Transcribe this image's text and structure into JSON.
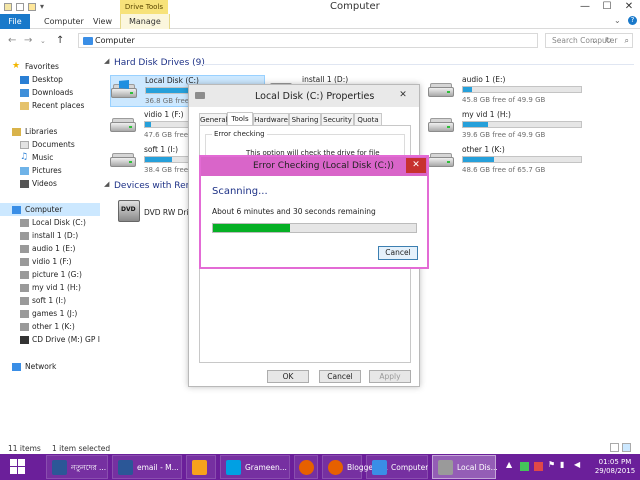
{
  "titlebar": {
    "context_tab": "Drive Tools",
    "title": "Computer",
    "min": "—",
    "max": "☐",
    "close": "✕"
  },
  "ribbon": {
    "file": "File",
    "tabs": [
      "Computer",
      "View",
      "Manage"
    ]
  },
  "address": {
    "path": "Computer",
    "search_placeholder": "Search Computer"
  },
  "nav": {
    "favorites": "Favorites",
    "desktop": "Desktop",
    "downloads": "Downloads",
    "recent": "Recent places",
    "libraries": "Libraries",
    "documents": "Documents",
    "music": "Music",
    "pictures": "Pictures",
    "videos": "Videos",
    "computer": "Computer",
    "drives": [
      "Local Disk (C:)",
      "install 1 (D:)",
      "audio 1 (E:)",
      "vidio 1 (F:)",
      "picture 1 (G:)",
      "my vid 1 (H:)",
      "soft 1 (I:)",
      "games 1 (J:)",
      "other 1 (K:)",
      "CD Drive (M:) GP Int"
    ],
    "network": "Network"
  },
  "content": {
    "hdd_header": "Hard Disk Drives (9)",
    "devices_header": "Devices with Remo",
    "drives": [
      {
        "name": "Local Disk (C:)",
        "free": "36.8 GB free o",
        "used": 0.38
      },
      {
        "name": "install 1 (D:)",
        "free": "",
        "used": 0.0
      },
      {
        "name": "audio 1 (E:)",
        "free": "45.8 GB free of 49.9 GB",
        "used": 0.08
      },
      {
        "name": "vidio 1 (F:)",
        "free": "47.6 GB free o",
        "used": 0.05
      },
      {
        "name": "my vid 1 (H:)",
        "free": "39.6 GB free of 49.9 GB",
        "used": 0.21
      },
      {
        "name": "soft 1 (I:)",
        "free": "38.4 GB free o",
        "used": 0.23
      },
      {
        "name": "other 1 (K:)",
        "free": "48.6 GB free of 65.7 GB",
        "used": 0.26
      }
    ],
    "dvd": "DVD RW Drive"
  },
  "status": {
    "items": "11 items",
    "selected": "1 item selected"
  },
  "props": {
    "title": "Local Disk (C:) Properties",
    "tabs": [
      "General",
      "Tools",
      "Hardware",
      "Sharing",
      "Security",
      "Quota"
    ],
    "group_title": "Error checking",
    "group_desc": "This option will check the drive for file",
    "ok": "OK",
    "cancel": "Cancel",
    "apply": "Apply"
  },
  "errchk": {
    "title": "Error Checking (Local Disk (C:))",
    "scanning": "Scanning...",
    "remaining": "About 6 minutes and 30 seconds remaining",
    "progress": 0.38,
    "cancel": "Cancel"
  },
  "taskbar": {
    "items": [
      "নতুনদের ...",
      "email - M...",
      "",
      "Grameen...",
      "",
      "Blogger: ...",
      "Computer",
      "Local Dis..."
    ],
    "time": "01:05 PM",
    "date": "29/08/2015"
  },
  "colors": {
    "accent": "#1979ca",
    "taskbar": "#6b1f9a",
    "dialog_border": "#e36bd5",
    "progress": "#06b025",
    "drive_bar": "#26a0da"
  }
}
